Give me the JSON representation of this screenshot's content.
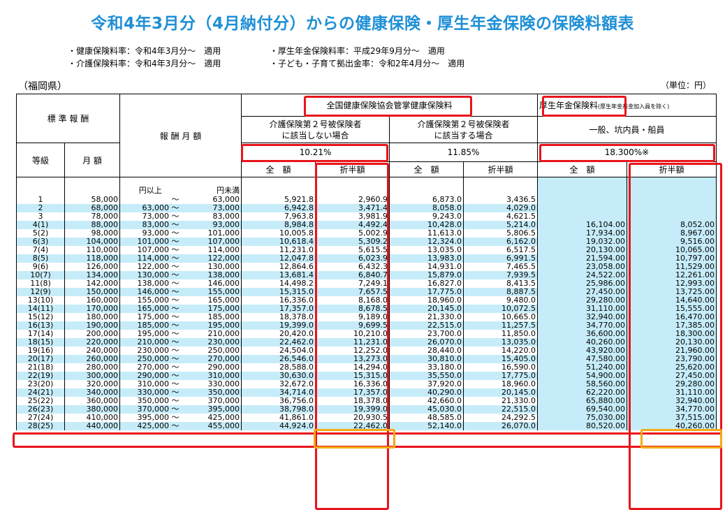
{
  "title": "令和4年3月分（4月納付分）からの健康保険・厚生年金保険の保険料額表",
  "notes_left": [
    "・健康保険料率：令和4年3月分～　適用",
    "・介護保険料率：令和4年3月分～　適用"
  ],
  "notes_right": [
    "・厚生年金保険料率：平成29年9月分～　適用",
    "・子ども・子育て拠出金率：令和2年4月分～　適用"
  ],
  "prefecture": "（福岡県）",
  "unit": "（単位：円）",
  "headers": {
    "standard": "標 準 報 酬",
    "grade": "等級",
    "monthly": "月 額",
    "range": "報 酬 月 額",
    "health": "全国健康保険協会管掌健康保険料",
    "pension": "厚生年金保険料",
    "pension_note": "(厚生年金基金加入員を除く)",
    "no_care": "介護保険第２号被保険者\nに該当しない場合",
    "care": "介護保険第２号被保険者\nに該当する場合",
    "general": "一般、坑内員・船員",
    "rate_no_care": "10.21%",
    "rate_care": "11.85%",
    "rate_pension": "18.300%※",
    "full": "全　額",
    "half": "折半額",
    "from_label": "円以上",
    "to_label": "円未満"
  },
  "colors": {
    "title": "#1e8fd6",
    "highlight_red": "#e8141b",
    "highlight_orange": "#f4aa14",
    "row_alt": "#c6ecf9"
  },
  "rows": [
    {
      "grade": "1",
      "monthly": "58,000",
      "from": "",
      "to": "63,000",
      "h_full": "5,921.8",
      "h_half": "2,960.9",
      "c_full": "6,873.0",
      "c_half": "3,436.5",
      "p_full": "",
      "p_half": ""
    },
    {
      "grade": "2",
      "monthly": "68,000",
      "from": "63,000",
      "to": "73,000",
      "h_full": "6,942.8",
      "h_half": "3,471.4",
      "c_full": "8,058.0",
      "c_half": "4,029.0",
      "p_full": "",
      "p_half": ""
    },
    {
      "grade": "3",
      "monthly": "78,000",
      "from": "73,000",
      "to": "83,000",
      "h_full": "7,963.8",
      "h_half": "3,981.9",
      "c_full": "9,243.0",
      "c_half": "4,621.5",
      "p_full": "",
      "p_half": ""
    },
    {
      "grade": "4(1)",
      "monthly": "88,000",
      "from": "83,000",
      "to": "93,000",
      "h_full": "8,984.8",
      "h_half": "4,492.4",
      "c_full": "10,428.0",
      "c_half": "5,214.0",
      "p_full": "16,104.00",
      "p_half": "8,052.00"
    },
    {
      "grade": "5(2)",
      "monthly": "98,000",
      "from": "93,000",
      "to": "101,000",
      "h_full": "10,005.8",
      "h_half": "5,002.9",
      "c_full": "11,613.0",
      "c_half": "5,806.5",
      "p_full": "17,934.00",
      "p_half": "8,967.00"
    },
    {
      "grade": "6(3)",
      "monthly": "104,000",
      "from": "101,000",
      "to": "107,000",
      "h_full": "10,618.4",
      "h_half": "5,309.2",
      "c_full": "12,324.0",
      "c_half": "6,162.0",
      "p_full": "19,032.00",
      "p_half": "9,516.00"
    },
    {
      "grade": "7(4)",
      "monthly": "110,000",
      "from": "107,000",
      "to": "114,000",
      "h_full": "11,231.0",
      "h_half": "5,615.5",
      "c_full": "13,035.0",
      "c_half": "6,517.5",
      "p_full": "20,130.00",
      "p_half": "10,065.00"
    },
    {
      "grade": "8(5)",
      "monthly": "118,000",
      "from": "114,000",
      "to": "122,000",
      "h_full": "12,047.8",
      "h_half": "6,023.9",
      "c_full": "13,983.0",
      "c_half": "6,991.5",
      "p_full": "21,594.00",
      "p_half": "10,797.00"
    },
    {
      "grade": "9(6)",
      "monthly": "126,000",
      "from": "122,000",
      "to": "130,000",
      "h_full": "12,864.6",
      "h_half": "6,432.3",
      "c_full": "14,931.0",
      "c_half": "7,465.5",
      "p_full": "23,058.00",
      "p_half": "11,529.00"
    },
    {
      "grade": "10(7)",
      "monthly": "134,000",
      "from": "130,000",
      "to": "138,000",
      "h_full": "13,681.4",
      "h_half": "6,840.7",
      "c_full": "15,879.0",
      "c_half": "7,939.5",
      "p_full": "24,522.00",
      "p_half": "12,261.00"
    },
    {
      "grade": "11(8)",
      "monthly": "142,000",
      "from": "138,000",
      "to": "146,000",
      "h_full": "14,498.2",
      "h_half": "7,249.1",
      "c_full": "16,827.0",
      "c_half": "8,413.5",
      "p_full": "25,986.00",
      "p_half": "12,993.00"
    },
    {
      "grade": "12(9)",
      "monthly": "150,000",
      "from": "146,000",
      "to": "155,000",
      "h_full": "15,315.0",
      "h_half": "7,657.5",
      "c_full": "17,775.0",
      "c_half": "8,887.5",
      "p_full": "27,450.00",
      "p_half": "13,725.00"
    },
    {
      "grade": "13(10)",
      "monthly": "160,000",
      "from": "155,000",
      "to": "165,000",
      "h_full": "16,336.0",
      "h_half": "8,168.0",
      "c_full": "18,960.0",
      "c_half": "9,480.0",
      "p_full": "29,280.00",
      "p_half": "14,640.00"
    },
    {
      "grade": "14(11)",
      "monthly": "170,000",
      "from": "165,000",
      "to": "175,000",
      "h_full": "17,357.0",
      "h_half": "8,678.5",
      "c_full": "20,145.0",
      "c_half": "10,072.5",
      "p_full": "31,110.00",
      "p_half": "15,555.00"
    },
    {
      "grade": "15(12)",
      "monthly": "180,000",
      "from": "175,000",
      "to": "185,000",
      "h_full": "18,378.0",
      "h_half": "9,189.0",
      "c_full": "21,330.0",
      "c_half": "10,665.0",
      "p_full": "32,940.00",
      "p_half": "16,470.00"
    },
    {
      "grade": "16(13)",
      "monthly": "190,000",
      "from": "185,000",
      "to": "195,000",
      "h_full": "19,399.0",
      "h_half": "9,699.5",
      "c_full": "22,515.0",
      "c_half": "11,257.5",
      "p_full": "34,770.00",
      "p_half": "17,385.00"
    },
    {
      "grade": "17(14)",
      "monthly": "200,000",
      "from": "195,000",
      "to": "210,000",
      "h_full": "20,420.0",
      "h_half": "10,210.0",
      "c_full": "23,700.0",
      "c_half": "11,850.0",
      "p_full": "36,600.00",
      "p_half": "18,300.00"
    },
    {
      "grade": "18(15)",
      "monthly": "220,000",
      "from": "210,000",
      "to": "230,000",
      "h_full": "22,462.0",
      "h_half": "11,231.0",
      "c_full": "26,070.0",
      "c_half": "13,035.0",
      "p_full": "40,260.00",
      "p_half": "20,130.00"
    },
    {
      "grade": "19(16)",
      "monthly": "240,000",
      "from": "230,000",
      "to": "250,000",
      "h_full": "24,504.0",
      "h_half": "12,252.0",
      "c_full": "28,440.0",
      "c_half": "14,220.0",
      "p_full": "43,920.00",
      "p_half": "21,960.00"
    },
    {
      "grade": "20(17)",
      "monthly": "260,000",
      "from": "250,000",
      "to": "270,000",
      "h_full": "26,546.0",
      "h_half": "13,273.0",
      "c_full": "30,810.0",
      "c_half": "15,405.0",
      "p_full": "47,580.00",
      "p_half": "23,790.00"
    },
    {
      "grade": "21(18)",
      "monthly": "280,000",
      "from": "270,000",
      "to": "290,000",
      "h_full": "28,588.0",
      "h_half": "14,294.0",
      "c_full": "33,180.0",
      "c_half": "16,590.0",
      "p_full": "51,240.00",
      "p_half": "25,620.00"
    },
    {
      "grade": "22(19)",
      "monthly": "300,000",
      "from": "290,000",
      "to": "310,000",
      "h_full": "30,630.0",
      "h_half": "15,315.0",
      "c_full": "35,550.0",
      "c_half": "17,775.0",
      "p_full": "54,900.00",
      "p_half": "27,450.00"
    },
    {
      "grade": "23(20)",
      "monthly": "320,000",
      "from": "310,000",
      "to": "330,000",
      "h_full": "32,672.0",
      "h_half": "16,336.0",
      "c_full": "37,920.0",
      "c_half": "18,960.0",
      "p_full": "58,560.00",
      "p_half": "29,280.00"
    },
    {
      "grade": "24(21)",
      "monthly": "340,000",
      "from": "330,000",
      "to": "350,000",
      "h_full": "34,714.0",
      "h_half": "17,357.0",
      "c_full": "40,290.0",
      "c_half": "20,145.0",
      "p_full": "62,220.00",
      "p_half": "31,110.00"
    },
    {
      "grade": "25(22)",
      "monthly": "360,000",
      "from": "350,000",
      "to": "370,000",
      "h_full": "36,756.0",
      "h_half": "18,378.0",
      "c_full": "42,660.0",
      "c_half": "21,330.0",
      "p_full": "65,880.00",
      "p_half": "32,940.00"
    },
    {
      "grade": "26(23)",
      "monthly": "380,000",
      "from": "370,000",
      "to": "395,000",
      "h_full": "38,798.0",
      "h_half": "19,399.0",
      "c_full": "45,030.0",
      "c_half": "22,515.0",
      "p_full": "69,540.00",
      "p_half": "34,770.00"
    },
    {
      "grade": "27(24)",
      "monthly": "410,000",
      "from": "395,000",
      "to": "425,000",
      "h_full": "41,861.0",
      "h_half": "20,930.5",
      "c_full": "48,585.0",
      "c_half": "24,292.5",
      "p_full": "75,030.00",
      "p_half": "37,515.00"
    },
    {
      "grade": "28(25)",
      "monthly": "440,000",
      "from": "425,000",
      "to": "455,000",
      "h_full": "44,924.0",
      "h_half": "22,462.0",
      "c_full": "52,140.0",
      "c_half": "26,070.0",
      "p_full": "80,520.00",
      "p_half": "40,260.00"
    }
  ]
}
